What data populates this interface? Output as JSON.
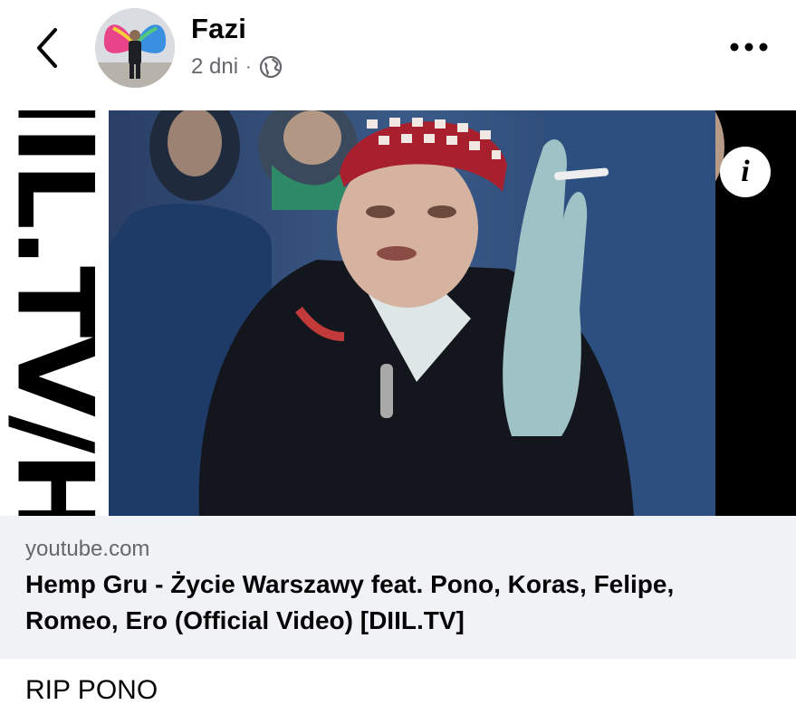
{
  "header": {
    "author_name": "Fazi",
    "timestamp": "2 dni",
    "separator": "·",
    "privacy_icon": "globe-icon",
    "back_icon": "chevron-left-icon",
    "more_icon": "more-horizontal-icon"
  },
  "video": {
    "watermark": "DIIL.TV/HD",
    "info_icon": "info-icon",
    "info_glyph": "i"
  },
  "link_preview": {
    "domain": "youtube.com",
    "title": "Hemp Gru - Życie Warszawy feat. Pono, Koras, Felipe, Romeo, Ero (Official Video) [DIIL.TV]"
  },
  "caption": "RIP PONO",
  "colors": {
    "card_background": "#f0f2f5",
    "secondary_text": "#65676b",
    "primary_text": "#050505"
  }
}
